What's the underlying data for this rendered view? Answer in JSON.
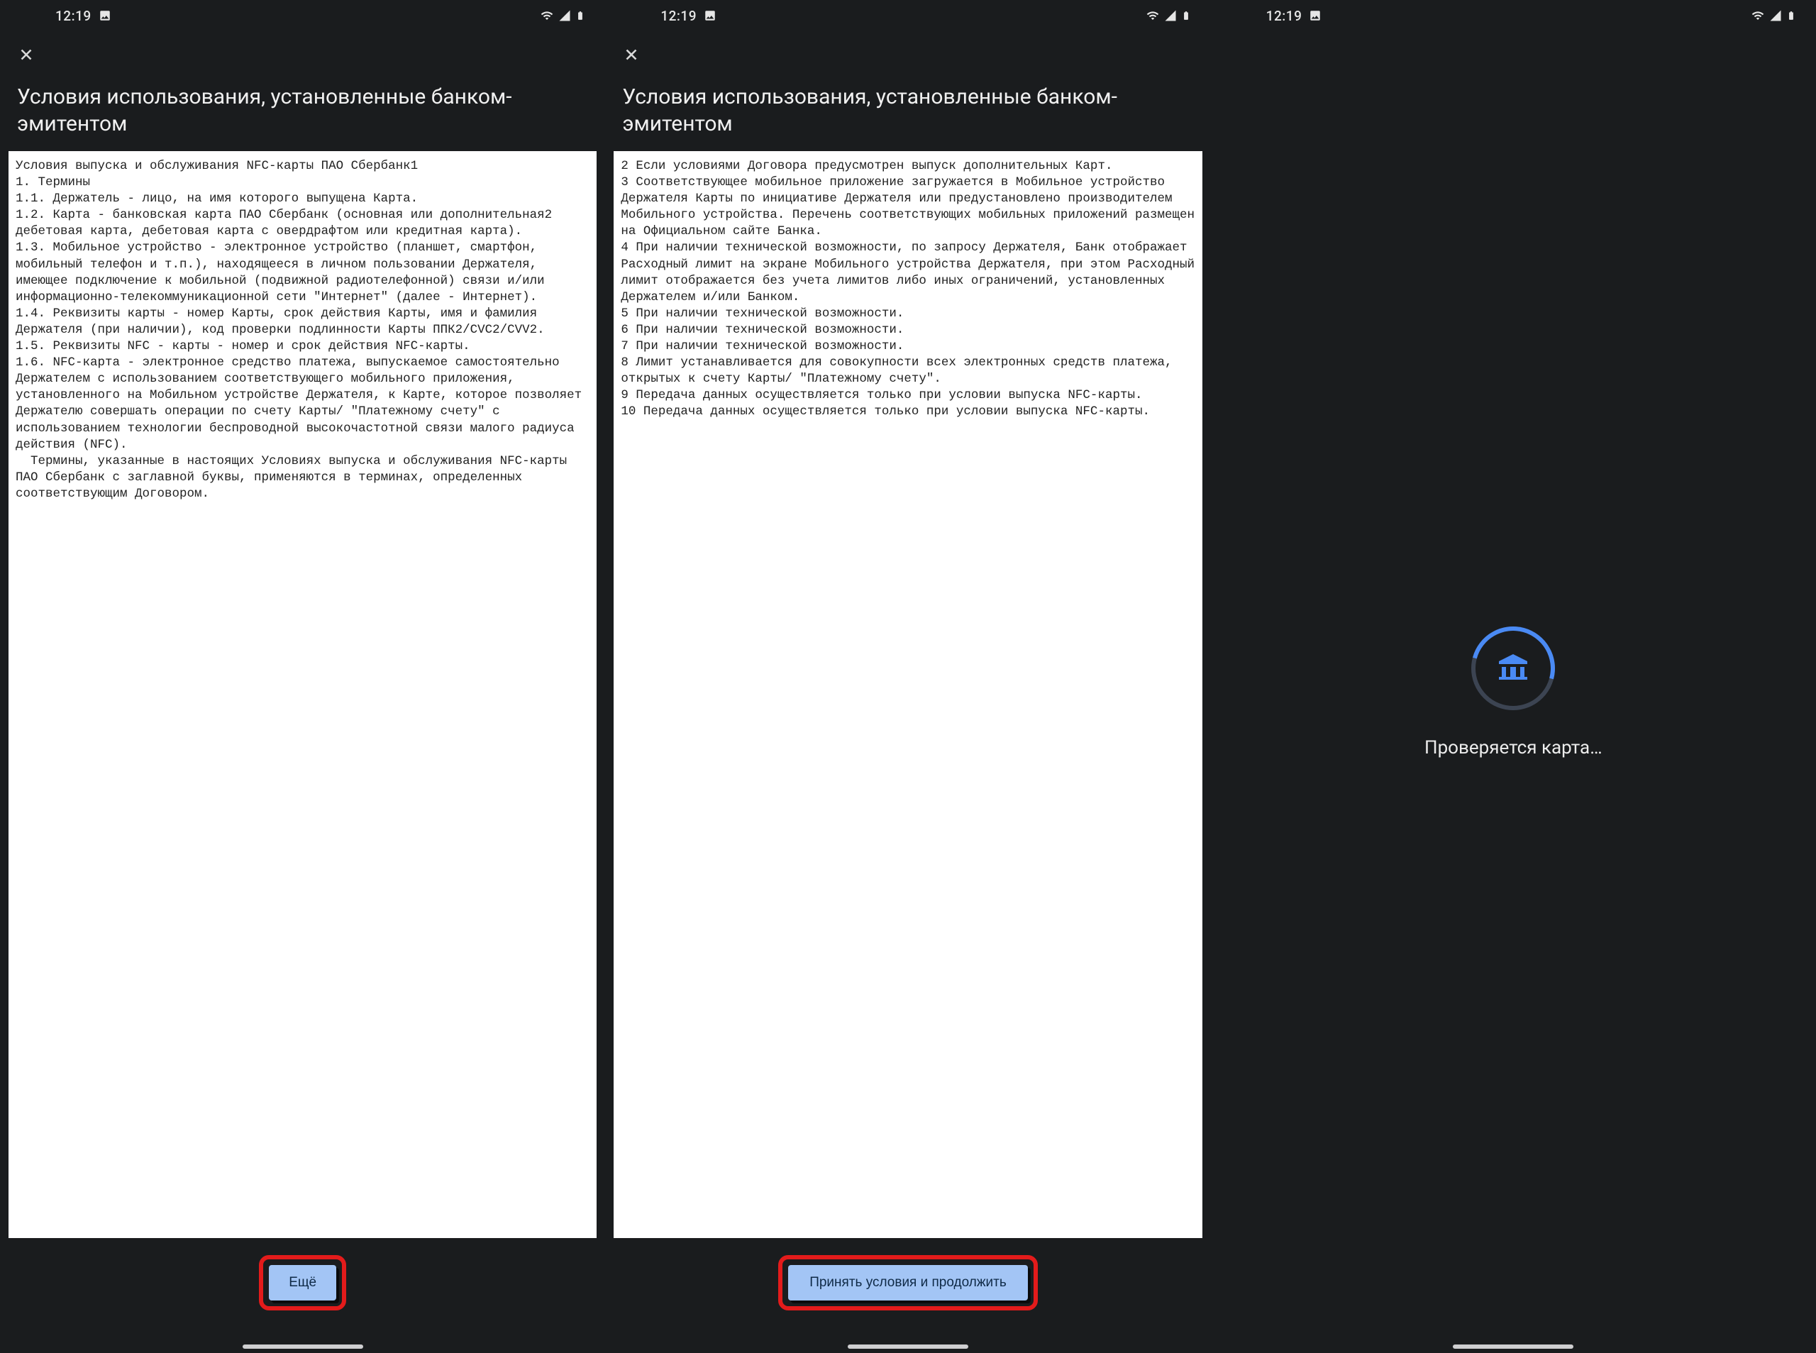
{
  "status": {
    "time": "12:19"
  },
  "screen1": {
    "title": "Условия использования, установленные банком-эмитентом",
    "terms_text": "Условия выпуска и обслуживания NFC-карты ПАО Сбербанк1\n1. Термины\n1.1. Держатель - лицо, на имя которого выпущена Карта.\n1.2. Карта - банковская карта ПАО Сбербанк (основная или дополнительная2 дебетовая карта, дебетовая карта с овердрафтом или кредитная карта).\n1.3. Мобильное устройство - электронное устройство (планшет, смартфон, мобильный телефон и т.п.), находящееся в личном пользовании Держателя, имеющее подключение к мобильной (подвижной радиотелефонной) связи и/или информационно-телекоммуникационной сети \"Интернет\" (далее - Интернет).\n1.4. Реквизиты карты - номер Карты, срок действия Карты, имя и фамилия Держателя (при наличии), код проверки подлинности Карты ППК2/CVC2/CVV2.\n1.5. Реквизиты NFC - карты - номер и срок действия NFC-карты.\n1.6. NFC-карта - электронное средство платежа, выпускаемое самостоятельно Держателем с использованием соответствующего мобильного приложения, установленного на Мобильном устройстве Держателя, к Карте, которое позволяет Держателю совершать операции по счету Карты/ \"Платежному счету\" с использованием технологии беспроводной высокочастотной связи малого радиуса действия (NFC).\n  Термины, указанные в настоящих Условиях выпуска и обслуживания NFC-карты ПАО Сбербанк с заглавной буквы, применяются в терминах, определенных соответствующим Договором.",
    "button_label": "Ещё"
  },
  "screen2": {
    "title": "Условия использования, установленные банком-эмитентом",
    "terms_text": "2 Если условиями Договора предусмотрен выпуск дополнительных Карт.\n3 Соответствующее мобильное приложение загружается в Мобильное устройство Держателя Карты по инициативе Держателя или предустановлено производителем Мобильного устройства. Перечень соответствующих мобильных приложений размещен на Официальном сайте Банка.\n4 При наличии технической возможности, по запросу Держателя, Банк отображает Расходный лимит на экране Мобильного устройства Держателя, при этом Расходный лимит отображается без учета лимитов либо иных ограничений, установленных Держателем и/или Банком.\n5 При наличии технической возможности.\n6 При наличии технической возможности.\n7 При наличии технической возможности.\n8 Лимит устанавливается для совокупности всех электронных средств платежа, открытых к счету Карты/ \"Платежному счету\".\n9 Передача данных осуществляется только при условии выпуска NFC-карты.\n10 Передача данных осуществляется только при условии выпуска NFC-карты.",
    "button_label": "Принять условия и продолжить"
  },
  "screen3": {
    "loading_text": "Проверяется карта…"
  }
}
